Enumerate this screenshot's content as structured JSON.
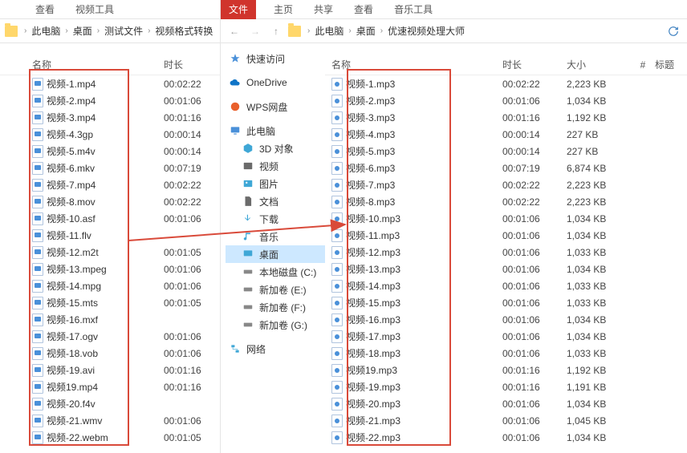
{
  "left": {
    "tabs": [
      "查看",
      "视频工具"
    ],
    "breadcrumb": [
      "此电脑",
      "桌面",
      "测试文件",
      "视频格式转换"
    ],
    "headers": {
      "name": "名称",
      "duration": "时长"
    },
    "files": [
      {
        "name": "视频-1.mp4",
        "dur": "00:02:22"
      },
      {
        "name": "视频-2.mp4",
        "dur": "00:01:06"
      },
      {
        "name": "视频-3.mp4",
        "dur": "00:01:16"
      },
      {
        "name": "视频-4.3gp",
        "dur": "00:00:14"
      },
      {
        "name": "视频-5.m4v",
        "dur": "00:00:14"
      },
      {
        "name": "视频-6.mkv",
        "dur": "00:07:19"
      },
      {
        "name": "视频-7.mp4",
        "dur": "00:02:22"
      },
      {
        "name": "视频-8.mov",
        "dur": "00:02:22"
      },
      {
        "name": "视频-10.asf",
        "dur": "00:01:06"
      },
      {
        "name": "视频-11.flv",
        "dur": ""
      },
      {
        "name": "视频-12.m2t",
        "dur": "00:01:05"
      },
      {
        "name": "视频-13.mpeg",
        "dur": "00:01:06"
      },
      {
        "name": "视频-14.mpg",
        "dur": "00:01:06"
      },
      {
        "name": "视频-15.mts",
        "dur": "00:01:05"
      },
      {
        "name": "视频-16.mxf",
        "dur": ""
      },
      {
        "name": "视频-17.ogv",
        "dur": "00:01:06"
      },
      {
        "name": "视频-18.vob",
        "dur": "00:01:06"
      },
      {
        "name": "视频-19.avi",
        "dur": "00:01:16"
      },
      {
        "name": "视频19.mp4",
        "dur": "00:01:16"
      },
      {
        "name": "视频-20.f4v",
        "dur": ""
      },
      {
        "name": "视频-21.wmv",
        "dur": "00:01:06"
      },
      {
        "name": "视频-22.webm",
        "dur": "00:01:05"
      }
    ]
  },
  "right": {
    "tabs": {
      "active": "文件",
      "rest": [
        "主页",
        "共享",
        "查看",
        "音乐工具"
      ]
    },
    "breadcrumb": [
      "此电脑",
      "桌面",
      "优速视频处理大师"
    ],
    "headers": {
      "name": "名称",
      "duration": "时长",
      "size": "大小",
      "idx": "#",
      "tag": "标题"
    },
    "sidebar": {
      "quick": "快速访问",
      "onedrive": "OneDrive",
      "wps": "WPS网盘",
      "thispc": "此电脑",
      "three_d": "3D 对象",
      "video": "视频",
      "pictures": "图片",
      "documents": "文档",
      "downloads": "下载",
      "music": "音乐",
      "desktop": "桌面",
      "local_c": "本地磁盘 (C:)",
      "vol_e": "新加卷 (E:)",
      "vol_f": "新加卷 (F:)",
      "vol_g": "新加卷 (G:)",
      "network": "网络"
    },
    "files": [
      {
        "name": "视频-1.mp3",
        "dur": "00:02:22",
        "size": "2,223 KB"
      },
      {
        "name": "视频-2.mp3",
        "dur": "00:01:06",
        "size": "1,034 KB"
      },
      {
        "name": "视频-3.mp3",
        "dur": "00:01:16",
        "size": "1,192 KB"
      },
      {
        "name": "视频-4.mp3",
        "dur": "00:00:14",
        "size": "227 KB"
      },
      {
        "name": "视频-5.mp3",
        "dur": "00:00:14",
        "size": "227 KB"
      },
      {
        "name": "视频-6.mp3",
        "dur": "00:07:19",
        "size": "6,874 KB"
      },
      {
        "name": "视频-7.mp3",
        "dur": "00:02:22",
        "size": "2,223 KB"
      },
      {
        "name": "视频-8.mp3",
        "dur": "00:02:22",
        "size": "2,223 KB"
      },
      {
        "name": "视频-10.mp3",
        "dur": "00:01:06",
        "size": "1,034 KB"
      },
      {
        "name": "视频-11.mp3",
        "dur": "00:01:06",
        "size": "1,034 KB"
      },
      {
        "name": "视频-12.mp3",
        "dur": "00:01:06",
        "size": "1,033 KB"
      },
      {
        "name": "视频-13.mp3",
        "dur": "00:01:06",
        "size": "1,034 KB"
      },
      {
        "name": "视频-14.mp3",
        "dur": "00:01:06",
        "size": "1,033 KB"
      },
      {
        "name": "视频-15.mp3",
        "dur": "00:01:06",
        "size": "1,033 KB"
      },
      {
        "name": "视频-16.mp3",
        "dur": "00:01:06",
        "size": "1,034 KB"
      },
      {
        "name": "视频-17.mp3",
        "dur": "00:01:06",
        "size": "1,034 KB"
      },
      {
        "name": "视频-18.mp3",
        "dur": "00:01:06",
        "size": "1,033 KB"
      },
      {
        "name": "视频19.mp3",
        "dur": "00:01:16",
        "size": "1,192 KB"
      },
      {
        "name": "视频-19.mp3",
        "dur": "00:01:16",
        "size": "1,191 KB"
      },
      {
        "name": "视频-20.mp3",
        "dur": "00:01:06",
        "size": "1,034 KB"
      },
      {
        "name": "视频-21.mp3",
        "dur": "00:01:06",
        "size": "1,045 KB"
      },
      {
        "name": "视频-22.mp3",
        "dur": "00:01:06",
        "size": "1,034 KB"
      }
    ]
  }
}
